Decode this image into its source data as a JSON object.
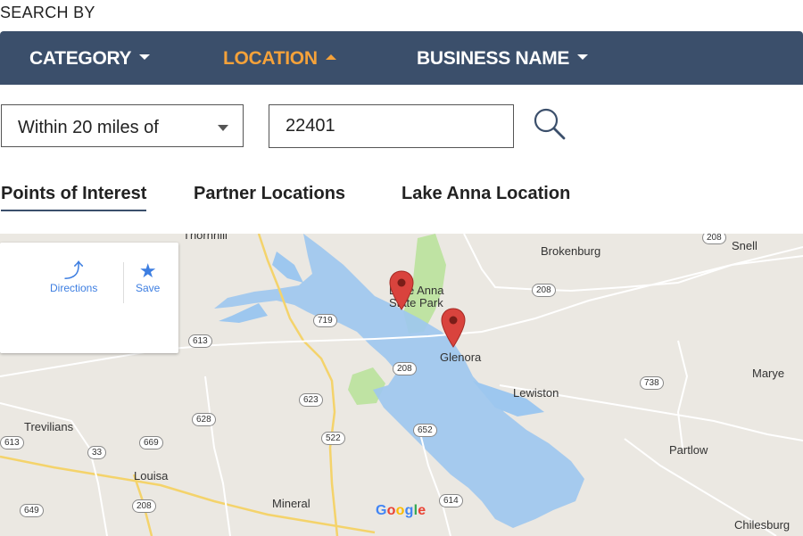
{
  "header": {
    "search_by_label": "SEARCH BY"
  },
  "nav": {
    "items": [
      {
        "label": "CATEGORY",
        "state": "collapsed"
      },
      {
        "label": "LOCATION",
        "state": "expanded"
      },
      {
        "label": "BUSINESS NAME",
        "state": "collapsed"
      }
    ],
    "active_color": "#f5a23a",
    "bar_color": "#3b4f6b"
  },
  "search": {
    "radius_selected": "Within 20 miles of",
    "zip_value": "22401"
  },
  "tabs": [
    {
      "label": "Points of Interest",
      "active": true
    },
    {
      "label": "Partner Locations",
      "active": false
    },
    {
      "label": "Lake Anna Location",
      "active": false
    }
  ],
  "map": {
    "infocard": {
      "directions_label": "Directions",
      "save_label": "Save"
    },
    "places": {
      "thornhill": "Thornhill",
      "lake_anna_1": "Lake Anna",
      "lake_anna_2": "State Park",
      "brokenburg": "Brokenburg",
      "snell": "Snell",
      "glenora": "Glenora",
      "lewiston": "Lewiston",
      "marye": "Marye",
      "trevilians": "Trevilians",
      "louisa": "Louisa",
      "mineral": "Mineral",
      "partlow": "Partlow",
      "chilesburg": "Chilesburg"
    },
    "routes": {
      "r208a": "208",
      "r208b": "208",
      "r208c": "208",
      "r208d": "208",
      "r719": "719",
      "r613a": "613",
      "r613b": "613",
      "r623": "623",
      "r628": "628",
      "r652": "652",
      "r738": "738",
      "r669": "669",
      "r33": "33",
      "r522": "522",
      "r649": "649",
      "r614": "614"
    },
    "brand": {
      "g1": "G",
      "o1": "o",
      "o2": "o",
      "g2": "g",
      "l": "l",
      "e": "e"
    }
  }
}
